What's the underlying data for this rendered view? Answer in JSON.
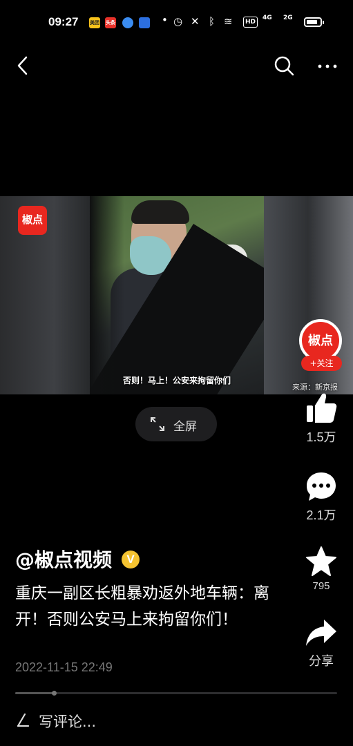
{
  "status_bar": {
    "time": "09:27",
    "app_icons": [
      {
        "name": "meituan-icon",
        "label": "美团",
        "color": "#f7c21b"
      },
      {
        "name": "toutiao-icon",
        "label": "头条",
        "color": "#e8322a"
      },
      {
        "name": "browser-icon",
        "label": "",
        "color": "#3b8cf0"
      },
      {
        "name": "app-icon",
        "label": "",
        "color": "#2c6fe0"
      }
    ],
    "hd_label": "HD",
    "net1_label": "4G",
    "net2_label": "2G",
    "battery_level": 0.85
  },
  "nav": {
    "back_icon": "chevron-left-icon",
    "search_icon": "search-icon",
    "more_icon": "more-dots-icon"
  },
  "video": {
    "logo_text": "椒点",
    "subtitle": "否则！马上！公安来拘留你们",
    "source": "来源：新京报"
  },
  "fullscreen": {
    "label": "全屏",
    "icon": "expand-icon"
  },
  "creator": {
    "avatar_text": "椒点",
    "follow_label": "+关注"
  },
  "actions": {
    "like": {
      "icon": "thumbs-up-icon",
      "count": "1.5万"
    },
    "comment": {
      "icon": "comment-bubble-icon",
      "count": "2.1万"
    },
    "favorite": {
      "icon": "star-icon",
      "count": "795"
    },
    "share": {
      "icon": "share-arrow-icon",
      "label": "分享"
    }
  },
  "post": {
    "author": "@椒点视频",
    "verified_symbol": "V",
    "caption": "重庆一副区长粗暴劝返外地车辆：离开！否则公安马上来拘留你们！",
    "date": "2022-11-15 22:49",
    "progress": 0.12
  },
  "comment_bar": {
    "placeholder": "写评论..."
  }
}
